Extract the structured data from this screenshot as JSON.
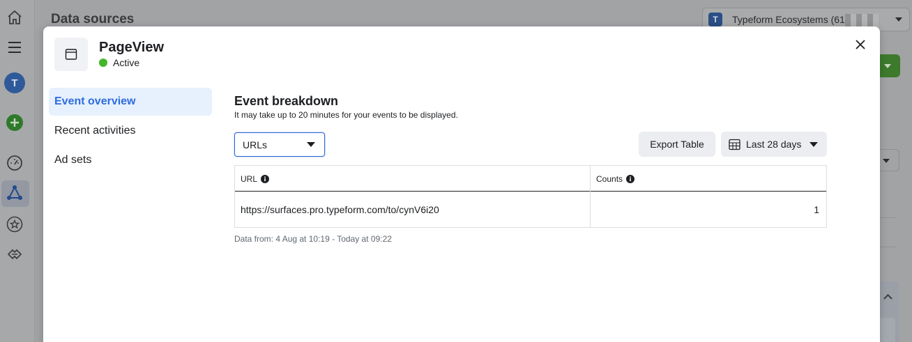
{
  "background": {
    "title": "Data sources",
    "account": {
      "avatar_letter": "T",
      "name": "Typeform Ecosystems (61"
    },
    "rail": {
      "avatar_letter": "T"
    }
  },
  "modal": {
    "event_name": "PageView",
    "status": "Active",
    "status_color": "#42b72a",
    "nav": [
      {
        "label": "Event overview",
        "active": true
      },
      {
        "label": "Recent activities",
        "active": false
      },
      {
        "label": "Ad sets",
        "active": false
      }
    ],
    "section": {
      "title": "Event breakdown",
      "subtitle": "It may take up to 20 minutes for your events to be displayed."
    },
    "breakdown_select": {
      "value": "URLs"
    },
    "export_label": "Export Table",
    "date_range": "Last 28 days",
    "table": {
      "headers": [
        "URL",
        "Counts"
      ],
      "rows": [
        {
          "url": "https://surfaces.pro.typeform.com/to/cynV6i20",
          "count": "1"
        }
      ]
    },
    "footnote": "Data from: 4 Aug at 10:19 - Today at 09:22"
  },
  "colors": {
    "accent": "#2d6ce0",
    "active_nav_bg": "#e7f0fd"
  }
}
